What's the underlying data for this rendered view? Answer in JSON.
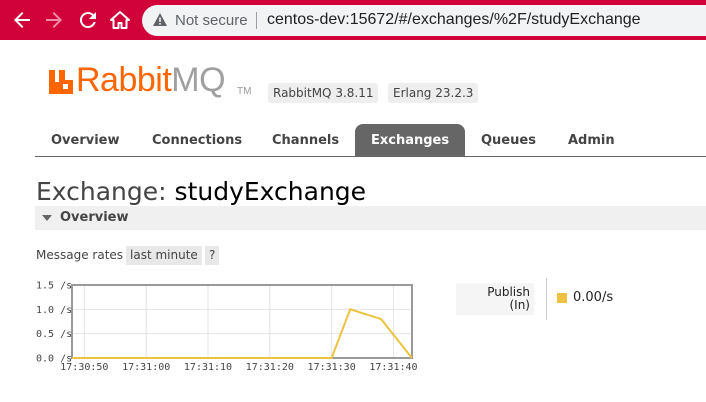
{
  "browser": {
    "security_label": "Not secure",
    "url": "centos-dev:15672/#/exchanges/%2F/studyExchange"
  },
  "header": {
    "logo_rabbit": "Rabbit",
    "logo_mq": "MQ",
    "logo_tm": "TM",
    "rabbitmq_version": "RabbitMQ 3.8.11",
    "erlang_version": "Erlang 23.2.3",
    "brand_color": "#ff6600"
  },
  "tabs": [
    {
      "label": "Overview",
      "active": false
    },
    {
      "label": "Connections",
      "active": false
    },
    {
      "label": "Channels",
      "active": false
    },
    {
      "label": "Exchanges",
      "active": true
    },
    {
      "label": "Queues",
      "active": false
    },
    {
      "label": "Admin",
      "active": false
    }
  ],
  "page": {
    "title_prefix": "Exchange:",
    "exchange_name": "studyExchange",
    "section_label": "Overview",
    "rates_label": "Message rates",
    "rates_range": "last minute",
    "rates_help": "?"
  },
  "legend": {
    "label_line1": "Publish",
    "label_line2": "(In)",
    "value": "0.00/s",
    "color": "#edc240"
  },
  "chart_data": {
    "type": "line",
    "title": "",
    "xlabel": "",
    "ylabel": "",
    "y_tick_labels": [
      "1.5 /s",
      "1.0 /s",
      "0.5 /s",
      "0.0 /s"
    ],
    "y_ticks": [
      1.5,
      1.0,
      0.5,
      0.0
    ],
    "x_tick_labels": [
      "17:30:50",
      "17:31:00",
      "17:31:10",
      "17:31:20",
      "17:31:30",
      "17:31:40"
    ],
    "x_ticks": [
      0,
      10,
      20,
      30,
      40,
      50
    ],
    "xlim": [
      -2,
      53
    ],
    "ylim": [
      0,
      1.5
    ],
    "grid": true,
    "series": [
      {
        "name": "Publish (In)",
        "color": "#edc240",
        "x": [
          -2,
          0,
          10,
          20,
          30,
          40,
          43,
          48,
          53
        ],
        "y": [
          0,
          0,
          0,
          0,
          0,
          0,
          1.0,
          0.8,
          0
        ]
      }
    ]
  }
}
